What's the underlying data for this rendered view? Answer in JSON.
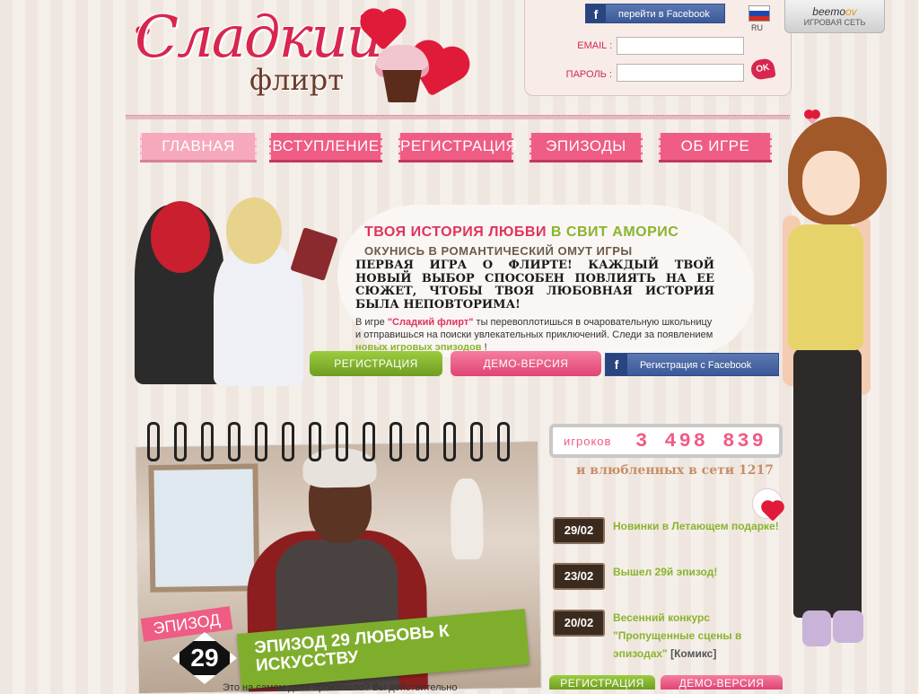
{
  "logo": {
    "title": "Сладкий",
    "subtitle": "флирт"
  },
  "facebook": {
    "icon": "facebook-icon",
    "connect_label": "перейти в Facebook"
  },
  "language": {
    "code": "RU",
    "flag_colors": [
      "#ffffff",
      "#1c48b0",
      "#d52b1e"
    ]
  },
  "login": {
    "email_label": "EMAIL :",
    "password_label": "ПАРОЛЬ :",
    "email_value": "",
    "password_value": "",
    "ok_label": "OK"
  },
  "beemoov": {
    "brand_prefix": "beemo",
    "brand_suffix": "ov",
    "tagline": "ИГРОВАЯ СЕТЬ"
  },
  "nav": {
    "items": [
      "ГЛАВНАЯ",
      "ВСТУПЛЕНИЕ",
      "РЕГИСТРАЦИЯ",
      "ЭПИЗОДЫ",
      "ОБ ИГРЕ"
    ]
  },
  "hero": {
    "title_part1": "ТВОЯ ИСТОРИЯ ЛЮБВИ",
    "title_part2": " В СВИТ АМОРИС",
    "subtitle": "ОКУНИСЬ В РОМАНТИЧЕСКИЙ ОМУТ ИГРЫ",
    "bold_text": "ПЕРВАЯ ИГРА О ФЛИРТЕ! КАЖДЫЙ ТВОЙ НОВЫЙ ВЫБОР СПОСОБЕН ПОВЛИЯТЬ НА ЕЕ СЮЖЕТ, ЧТОБЫ ТВОЯ ЛЮБОВНАЯ ИСТОРИЯ БЫЛА НЕПОВТОРИМА!",
    "desc_prefix": "В игре ",
    "desc_game": "\"Сладкий флирт\"",
    "desc_middle": " ты перевоплотишься в очаровательную школьницу и отправишься на поиски увлекательных приключений. Следи за появлением ",
    "desc_link": "новых игровых эпизодов",
    "desc_suffix": " !",
    "register_label": "Регистрация",
    "demo_label": "Демо-версия",
    "fb_register_label": "Регистрация с Facebook"
  },
  "episode": {
    "badge_label": "ЭПИЗОД",
    "number": "29",
    "title": "ЭПИЗОД 29 ЛЮБОВЬ К ИСКУССТВУ",
    "teaser": "Это на самом деле произошло? Вы действительно"
  },
  "stats": {
    "players_label": "игроков",
    "players_count": "3 498 839",
    "online_text": "и влюбленных в сети 1217"
  },
  "news": [
    {
      "date": "29/02",
      "title": "Новинки в Летающем подарке!",
      "extra": ""
    },
    {
      "date": "23/02",
      "title": "Вышел 29й эпизод!",
      "extra": ""
    },
    {
      "date": "20/02",
      "title": "Весенний конкурс \"Пропущенные сцены в эпизодах\"",
      "extra": " [Комикс]"
    }
  ],
  "bottom_buttons": {
    "register_label": "Регистрация",
    "demo_label": "Демо-версия"
  },
  "colors": {
    "pink": "#ef5c84",
    "green": "#8ab42e",
    "brand_red": "#d8264f",
    "facebook": "#3b5998"
  }
}
